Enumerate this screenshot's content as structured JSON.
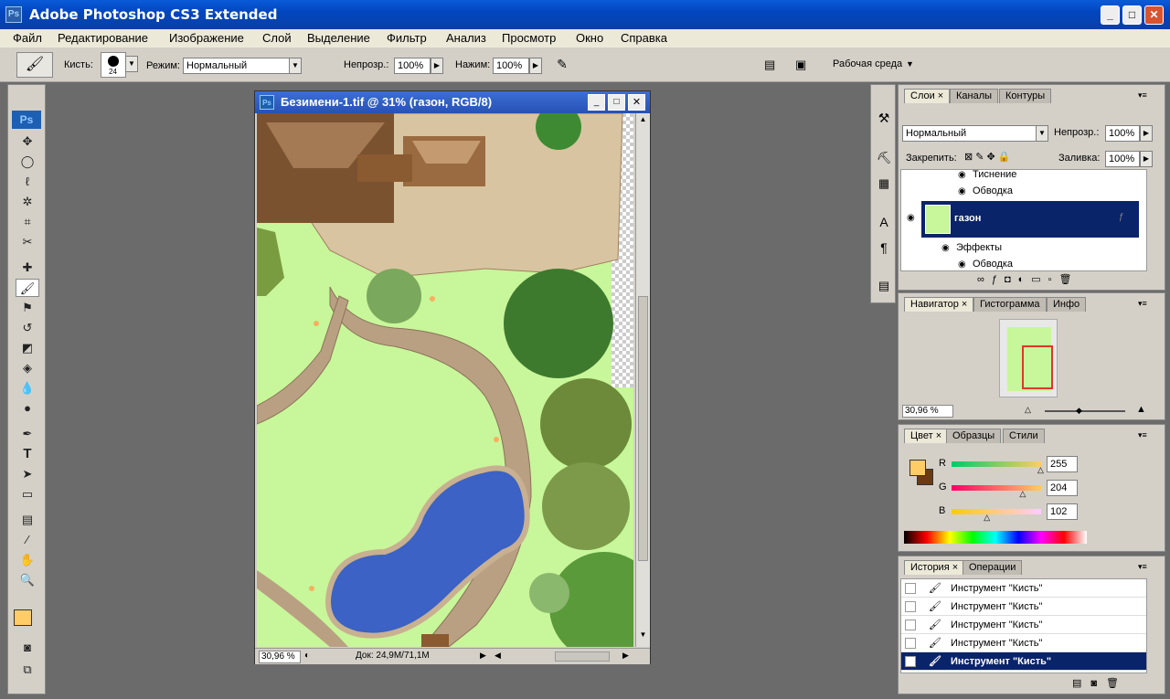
{
  "window": {
    "title": "Adobe Photoshop CS3 Extended",
    "icon": "Ps"
  },
  "menu": [
    "Файл",
    "Редактирование",
    "Изображение",
    "Слой",
    "Выделение",
    "Фильтр",
    "Анализ",
    "Просмотр",
    "Окно",
    "Справка"
  ],
  "options": {
    "brush_label": "Кисть:",
    "brush_size": "24",
    "mode_label": "Режим:",
    "mode_value": "Нормальный",
    "opacity_label": "Непрозр.:",
    "opacity_value": "100%",
    "flow_label": "Нажим:",
    "flow_value": "100%",
    "workspace": "Рабочая среда"
  },
  "toolbox": {
    "logo": "Ps",
    "fg_color": "#ffcc66",
    "bg_color": "#6b3a10"
  },
  "document": {
    "title": "Безимени-1.tif @ 31% (газон, RGB/8)",
    "icon": "Ps",
    "zoom": "30,96 %",
    "doc_info": "Док: 24,9M/71,1M"
  },
  "layers_panel": {
    "tabs": [
      "Слои",
      "Каналы",
      "Контуры"
    ],
    "blend_mode": "Нормальный",
    "opacity_label": "Непрозр.:",
    "opacity_value": "100%",
    "lock_label": "Закрепить:",
    "fill_label": "Заливка:",
    "fill_value": "100%",
    "rows": [
      {
        "label": "Тиснение"
      },
      {
        "label": "Обводка"
      },
      {
        "label": "газон",
        "selected": true
      },
      {
        "label": "Эффекты"
      },
      {
        "label": "Обводка"
      }
    ]
  },
  "navigator_panel": {
    "tabs": [
      "Навигатор",
      "Гистограмма",
      "Инфо"
    ],
    "zoom": "30,96 %"
  },
  "color_panel": {
    "tabs": [
      "Цвет",
      "Образцы",
      "Стили"
    ],
    "channels": [
      {
        "name": "R",
        "value": "255",
        "level": 255
      },
      {
        "name": "G",
        "value": "204",
        "level": 204
      },
      {
        "name": "B",
        "value": "102",
        "level": 102
      }
    ]
  },
  "history_panel": {
    "tabs": [
      "История",
      "Операции"
    ],
    "items": [
      "Инструмент \"Кисть\"",
      "Инструмент \"Кисть\"",
      "Инструмент \"Кисть\"",
      "Инструмент \"Кисть\"",
      "Инструмент \"Кисть\""
    ],
    "selected_index": 4
  }
}
